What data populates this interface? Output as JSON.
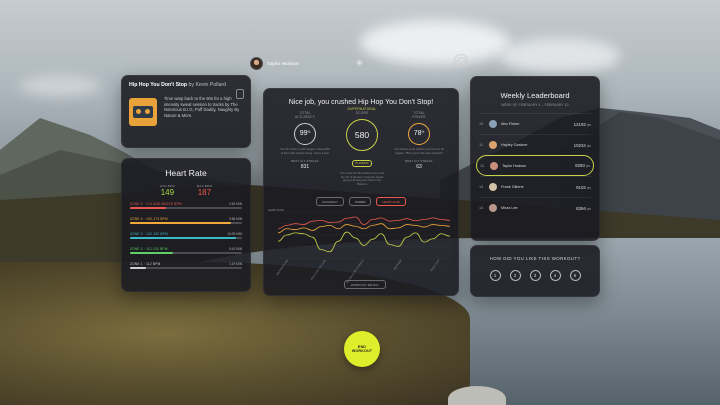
{
  "topbar": {
    "user_name": "Taylor Hudson"
  },
  "song": {
    "title": "Hip Hop You Don't Stop",
    "by": "by Kevin Pollard",
    "description": "Time warp back to the 90s for a high intensity sweat session to tracks by The Notorious B.I.G, Puff Daddy, Naughty By Nature & More."
  },
  "heart_rate": {
    "title": "Heart Rate",
    "avg_label": "AVG BPM",
    "avg_value": "149",
    "max_label": "MAX BPM",
    "max_value": "187",
    "zones": [
      {
        "label": "ZONE 5 · 174 AND ABOVE BPM",
        "time": "0:52 MIN",
        "color": "#e9574f",
        "fraction": 0.32
      },
      {
        "label": "ZONE 4 · 152-173 BPM",
        "time": "9:56 MIN",
        "color": "#f2a93b",
        "fraction": 0.9
      },
      {
        "label": "ZONE 3 · 132-152 BPM",
        "time": "13:09 MIN",
        "color": "#3db9c9",
        "fraction": 0.95
      },
      {
        "label": "ZONE 2 · 112-132 BPM",
        "time": "5:42 MIN",
        "color": "#5fcf67",
        "fraction": 0.38
      },
      {
        "label": "ZONE 1 · 112 BPM",
        "time": "1:19 MIN",
        "color": "#cfcfd4",
        "fraction": 0.14
      }
    ]
  },
  "summary": {
    "title": "Nice job, you crushed Hip Hop You Don't Stop!",
    "accuracy": {
      "label_1": "TOTAL",
      "label_2": "ACCURACY",
      "value": "99",
      "unit": "%",
      "ring_color": "#cfcfd4",
      "desc": "You hit 1,000 of 1,010 targets, hitting 99% of them with perfect timing. You're a star!",
      "sub_label": "BEST HIT STREAK",
      "sub_value": "831"
    },
    "score": {
      "label_1": "SUPERNATURAL",
      "label_2": "SCORE",
      "value": "580",
      "ring_color": "#c9d348",
      "badge": "PLATINUM",
      "desc": "Your score for this workout was in the top 1% of all users. Keep the streak going and keep your rank in the Platinum"
    },
    "power": {
      "label_1": "TOTAL",
      "label_2": "POWER",
      "value": "78",
      "unit": "%",
      "ring_color": "#f2a93b",
      "desc": "Your Power score reflects your force to hit targets. 78% of your hits were powerful!",
      "sub_label": "BEST HIT STREAK",
      "sub_value": "63"
    },
    "graph_tabs": [
      "ACCURACY",
      "POWER",
      "HEART RATE"
    ],
    "graph_tab_active": 2,
    "graph_ylabel": "HEART RATE",
    "songs": [
      "Hip Hop Hooray",
      "How Come The Lady",
      "Mo Money Mo Problems",
      "Big Poppa",
      "Deep Cover"
    ],
    "summary_button": "WORKOUT DETAIL"
  },
  "leaderboard": {
    "title": "Weekly Leaderboard",
    "week": "WEEK OF FEBRUARY 4 – FEBRUARY 10",
    "rows": [
      {
        "rank": "10",
        "name": "Abu Fisher",
        "score": "12192",
        "unit": "pts",
        "avatar": "#8aa1b8",
        "me": false
      },
      {
        "rank": "11",
        "name": "Hayley Gardner",
        "score": "10234",
        "unit": "pts",
        "avatar": "#d9a36b",
        "me": false
      },
      {
        "rank": "12",
        "name": "Taylor Hudson",
        "score": "9283",
        "unit": "pts",
        "avatar": "#c88f7a",
        "me": true
      },
      {
        "rank": "13",
        "name": "Frank Gillene",
        "score": "9102",
        "unit": "pts",
        "avatar": "#d3c1a8",
        "me": false
      },
      {
        "rank": "14",
        "name": "Mirza Lee",
        "score": "8394",
        "unit": "pts",
        "avatar": "#b9968b",
        "me": false
      }
    ]
  },
  "rating": {
    "question": "HOW DID YOU LIKE THIS WORKOUT?",
    "options": [
      "1",
      "2",
      "3",
      "4",
      "5"
    ]
  },
  "end_workout": {
    "line1": "END",
    "line2": "WORKOUT"
  },
  "chart_data": {
    "type": "line",
    "x": [
      0,
      5,
      10,
      15,
      20,
      25,
      30,
      35,
      40,
      45,
      50,
      55,
      60,
      65,
      70,
      75,
      80,
      85,
      90,
      95,
      100
    ],
    "series": [
      {
        "color": "#e9574f",
        "values": [
          150,
          158,
          162,
          160,
          168,
          170,
          165,
          166,
          175,
          178,
          160,
          172,
          176,
          168,
          170,
          174,
          169,
          172,
          176,
          172,
          170
        ]
      },
      {
        "color": "#c9d348",
        "values": [
          120,
          135,
          140,
          138,
          130,
          100,
          95,
          120,
          142,
          128,
          110,
          125,
          138,
          112,
          108,
          130,
          140,
          118,
          126,
          138,
          132
        ]
      },
      {
        "color": "#f2a93b",
        "values": [
          140,
          150,
          148,
          152,
          146,
          155,
          158,
          150,
          160,
          156,
          150,
          158,
          162,
          150,
          152,
          160,
          158,
          154,
          160,
          158,
          156
        ]
      }
    ],
    "ylim": [
      80,
      190
    ]
  }
}
